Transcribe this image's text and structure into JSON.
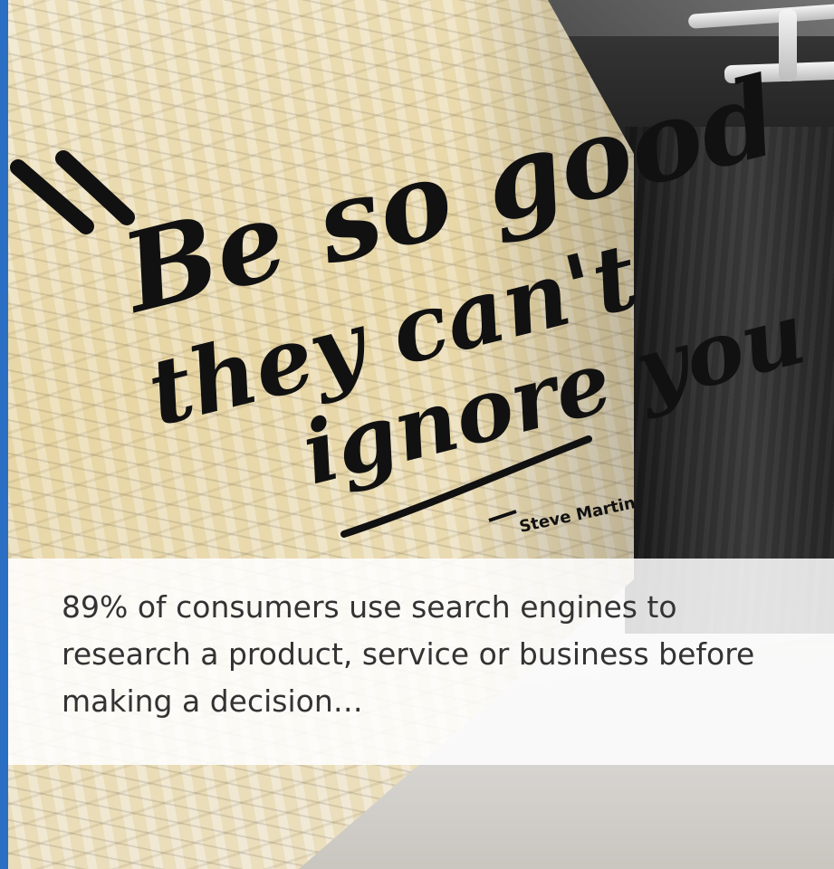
{
  "image": {
    "accent_color": "#2b6fc4",
    "overlay_color": "#ffffff",
    "text_color": "#333333"
  },
  "mural": {
    "quote_line_1": "Be so good",
    "quote_line_2": "they can't",
    "quote_line_3": "ignore you",
    "attribution": "Steve Martin"
  },
  "caption": {
    "text": "89% of consumers use search engines to research a product, service or business before making a decision…"
  }
}
